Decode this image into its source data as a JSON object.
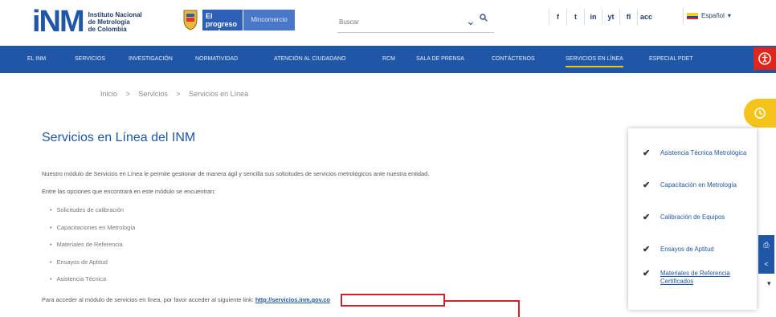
{
  "header": {
    "logo_mark": "iNM",
    "logo_text_lines": [
      "Instituto Nacional",
      "de Metrología",
      "de Colombia"
    ],
    "gov_label": "El progreso es de todos",
    "gov2_label": "Mincomercio",
    "search_placeholder": "Buscar",
    "social": [
      "f",
      "t",
      "in",
      "yt",
      "fl",
      "acc"
    ],
    "language": "Español"
  },
  "nav": {
    "items": [
      {
        "label": "EL INM"
      },
      {
        "label": "SERVICIOS"
      },
      {
        "label": "INVESTIGACIÓN"
      },
      {
        "label": "NORMATIVIDAD"
      },
      {
        "label": "ATENCIÓN AL CIUDADANO"
      },
      {
        "label": "RCM"
      },
      {
        "label": "SALA DE PRENSA"
      },
      {
        "label": "CONTÁCTENOS"
      },
      {
        "label": "SERVICIOS EN LÍNEA"
      },
      {
        "label": "ESPECIAL PDET"
      }
    ]
  },
  "breadcrumb": [
    "Inicio",
    ">",
    "Servicios",
    ">",
    "Servicios en Línea"
  ],
  "main": {
    "title": "Servicios en Línea del INM",
    "intro": "Nuestro módulo de Servicios en Línea le permite gestionar de manera ágil y sencilla sus solicitudes de servicios metrológicos ante nuestra entidad.",
    "options_intro": "Entre las opciones que encontrará en este módulo se encuentran:",
    "options": [
      "Solicitudes de calibración",
      "Capacitaciones en Metrología",
      "Materiales de Referencia",
      "Ensayos de Aptitud",
      "Asistencia Técnica"
    ],
    "access_text": "Para acceder al módulo de servicios en línea, por favor acceder al siguiente link:",
    "access_link": "http://servicios.inm.gov.co"
  },
  "sidepanel": {
    "items": [
      {
        "label": "Asistencia Técnica Metrológica"
      },
      {
        "label": "Capacitación en Metrología"
      },
      {
        "label": "Calibración de Equipos"
      },
      {
        "label": "Ensayos de Aptitud"
      },
      {
        "label": "Materiales de Referencia Certificados"
      }
    ]
  },
  "colors": {
    "brand": "#1f57a6",
    "accent": "#f2c21a",
    "highlight": "#c9252c"
  }
}
